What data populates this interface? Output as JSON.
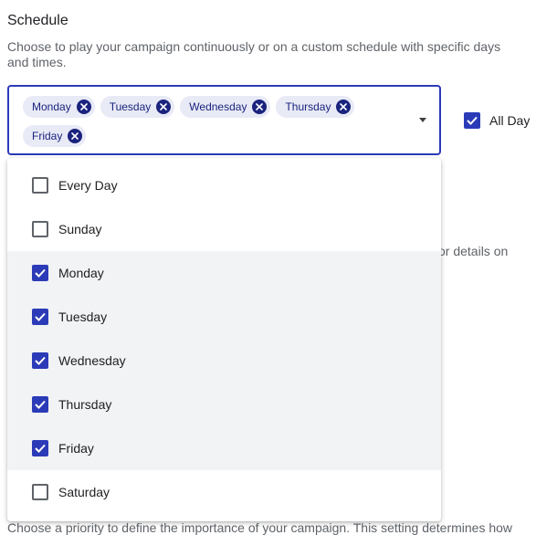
{
  "schedule": {
    "title": "Schedule",
    "description": "Choose to play your campaign continuously or on a custom schedule with specific days and times."
  },
  "selected_chips": [
    "Monday",
    "Tuesday",
    "Wednesday",
    "Thursday",
    "Friday"
  ],
  "all_day": {
    "label": "All Day",
    "checked": true
  },
  "menu": {
    "items": [
      {
        "label": "Every Day",
        "checked": false
      },
      {
        "label": "Sunday",
        "checked": false
      },
      {
        "label": "Monday",
        "checked": true
      },
      {
        "label": "Tuesday",
        "checked": true
      },
      {
        "label": "Wednesday",
        "checked": true
      },
      {
        "label": "Thursday",
        "checked": true
      },
      {
        "label": "Friday",
        "checked": true
      },
      {
        "label": "Saturday",
        "checked": false
      }
    ]
  },
  "background": {
    "partial_right_text": "or details on",
    "partial_bottom_text": "Choose a priority to define the importance of your campaign. This setting determines how"
  },
  "colors": {
    "accent": "#2b3bb8",
    "chip_bg": "#e8eaf6",
    "chip_text": "#1a237e"
  }
}
